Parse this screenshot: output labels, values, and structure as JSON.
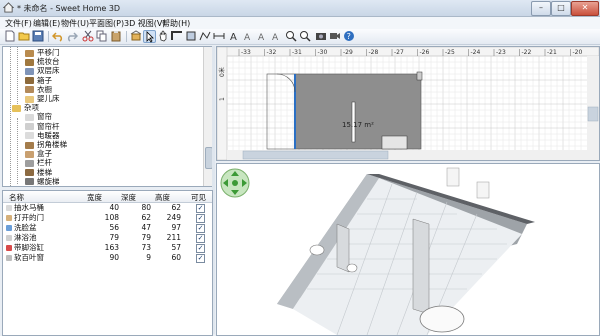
{
  "window": {
    "title": "* 未命名 - Sweet Home 3D",
    "min": "–",
    "max": "□",
    "close": "✕"
  },
  "menu": [
    "文件(F)",
    "编辑(E)",
    "物件(U)",
    "平面图(P)",
    "3D 视图(V)",
    "帮助(H)"
  ],
  "catalog": {
    "items": [
      {
        "label": "平移门",
        "color": "#b98b4e",
        "indent": 2
      },
      {
        "label": "梳妆台",
        "color": "#a0783f",
        "indent": 2
      },
      {
        "label": "双层床",
        "color": "#7f94b8",
        "indent": 2
      },
      {
        "label": "箱子",
        "color": "#8d6a3b",
        "indent": 2
      },
      {
        "label": "衣橱",
        "color": "#b38a5a",
        "indent": 2
      },
      {
        "label": "婴儿床",
        "color": "#e8c77c",
        "indent": 2
      },
      {
        "label": "杂项",
        "color": "#e6c15a",
        "indent": 1
      },
      {
        "label": "窗帘",
        "color": "#dadada",
        "indent": 2
      },
      {
        "label": "窗帘杆",
        "color": "#cfcfcf",
        "indent": 2
      },
      {
        "label": "电暖器",
        "color": "#dcdcdc",
        "indent": 2
      },
      {
        "label": "拐角楼梯",
        "color": "#a47c4b",
        "indent": 2
      },
      {
        "label": "盒子",
        "color": "#c9a070",
        "indent": 2
      },
      {
        "label": "栏杆",
        "color": "#9e9e9e",
        "indent": 2
      },
      {
        "label": "楼梯",
        "color": "#8c6a42",
        "indent": 2
      },
      {
        "label": "螺旋梯",
        "color": "#777777",
        "indent": 2
      }
    ]
  },
  "furniture": {
    "headers": {
      "name": "名称",
      "width": "宽度",
      "depth": "深度",
      "height": "高度",
      "visible": "可见"
    },
    "rows": [
      {
        "name": "抽水马桶",
        "width": "40",
        "depth": "80",
        "height": "62",
        "visible": true,
        "color": "#d9d9d9"
      },
      {
        "name": "打开的门",
        "width": "108",
        "depth": "62",
        "height": "249",
        "visible": true,
        "color": "#d6b07a"
      },
      {
        "name": "洗脸盆",
        "width": "56",
        "depth": "47",
        "height": "97",
        "visible": true,
        "color": "#6a9ed8"
      },
      {
        "name": "淋浴池",
        "width": "79",
        "depth": "79",
        "height": "211",
        "visible": true,
        "color": "#cfcfcf"
      },
      {
        "name": "带脚浴缸",
        "width": "163",
        "depth": "73",
        "height": "57",
        "visible": true,
        "color": "#d84a4a"
      },
      {
        "name": "软百叶窗",
        "width": "90",
        "depth": "9",
        "height": "60",
        "visible": true,
        "color": "#bdbdbd"
      }
    ]
  },
  "plan": {
    "ruler_top": [
      "-33",
      "-32",
      "-31",
      "-30",
      "-29",
      "-28",
      "-27",
      "-26",
      "-25",
      "-24",
      "-23",
      "-22",
      "-21",
      "-20"
    ],
    "ruler_left": [
      "0米",
      "1"
    ],
    "room_area": "15.17 m²"
  },
  "colors": {
    "accent": "#2a6fc4",
    "window_bg": "#e9eef4"
  }
}
